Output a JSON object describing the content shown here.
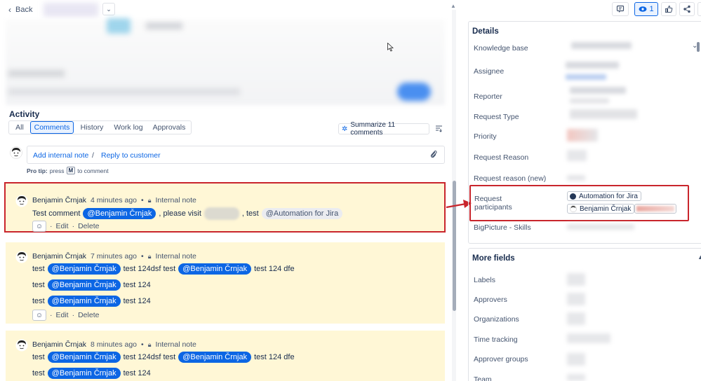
{
  "header": {
    "back_label": "Back",
    "watch_count": "1"
  },
  "activity": {
    "title": "Activity",
    "tabs": [
      {
        "label": "All"
      },
      {
        "label": "Comments"
      },
      {
        "label": "History"
      },
      {
        "label": "Work log"
      },
      {
        "label": "Approvals"
      }
    ],
    "summarize_label": "Summarize 11 comments",
    "composer": {
      "add_internal_note": "Add internal note",
      "separator": "/",
      "reply_to_customer": "Reply to customer"
    },
    "pro_tip_prefix": "Pro tip:",
    "pro_tip_press": "press",
    "pro_tip_key": "M",
    "pro_tip_suffix": "to comment"
  },
  "comments": [
    {
      "author": "Benjamin Črnjak",
      "time": "4 minutes ago",
      "visibility": "Internal note",
      "text_before": "Test comment",
      "mention": "@Benjamin Črnjak",
      "text_mid": ", please visit",
      "text_after": ", test",
      "mention_grey": "@Automation for Jira",
      "edit": "Edit",
      "delete": "Delete"
    },
    {
      "author": "Benjamin Črnjak",
      "time": "7 minutes ago",
      "visibility": "Internal note",
      "line1": {
        "a": "test",
        "m1": "@Benjamin Črnjak",
        "b": "test 124dsf test",
        "m2": "@Benjamin Črnjak",
        "c": "test 124 dfe"
      },
      "line2": {
        "a": "test",
        "m1": "@Benjamin Črnjak",
        "b": "test 124"
      },
      "line3": {
        "a": "test",
        "m1": "@Benjamin Črnjak",
        "b": "test 124"
      },
      "edit": "Edit",
      "delete": "Delete"
    },
    {
      "author": "Benjamin Črnjak",
      "time": "8 minutes ago",
      "visibility": "Internal note",
      "line1": {
        "a": "test",
        "m1": "@Benjamin Črnjak",
        "b": "test 124dsf test",
        "m2": "@Benjamin Črnjak",
        "c": "test 124 dfe"
      },
      "line2": {
        "a": "test",
        "m1": "@Benjamin Črnjak",
        "b": "test 124"
      }
    }
  ],
  "details": {
    "title": "Details",
    "fields": {
      "knowledge_base": "Knowledge base",
      "assignee": "Assignee",
      "reporter": "Reporter",
      "request_type": "Request Type",
      "priority": "Priority",
      "request_reason": "Request Reason",
      "request_reason_new": "Request reason (new)",
      "request_participants_1": "Request",
      "request_participants_2": "participants",
      "bigpicture_skills": "BigPicture - Skills"
    },
    "participants": [
      {
        "name": "Automation for Jira"
      },
      {
        "name": "Benjamin Črnjak"
      }
    ]
  },
  "more_fields": {
    "title": "More fields",
    "fields": [
      "Labels",
      "Approvers",
      "Organizations",
      "Time tracking",
      "Approver groups",
      "Team"
    ]
  },
  "colors": {
    "accent": "#0c66e4",
    "highlight_border": "#c9252c",
    "note_bg": "#fff7d6"
  }
}
